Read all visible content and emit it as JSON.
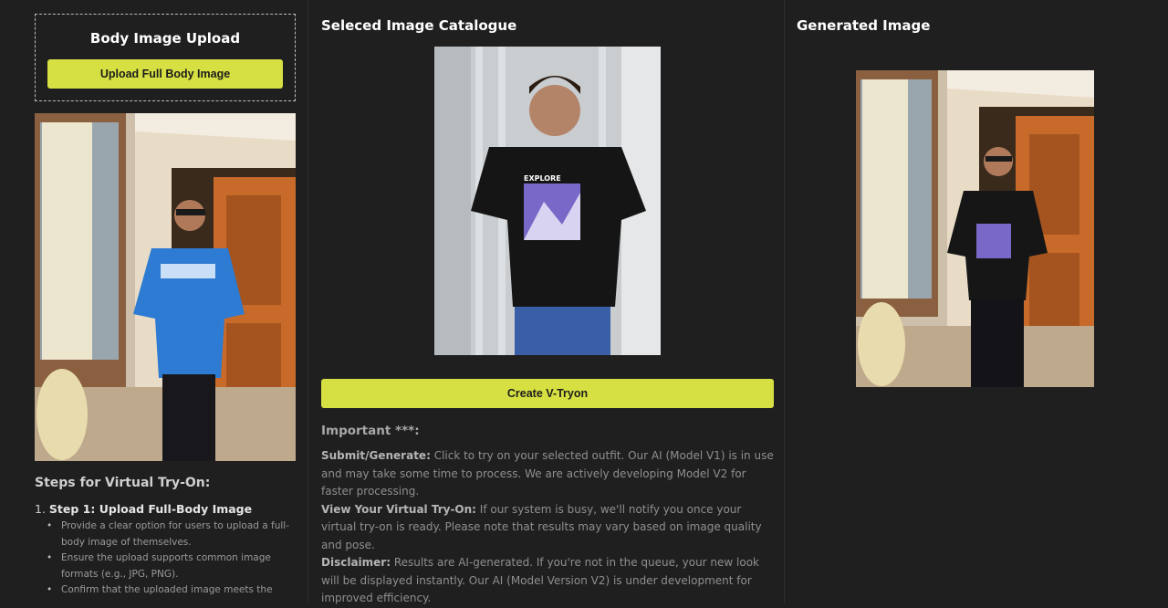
{
  "upload": {
    "title": "Body Image Upload",
    "button_label": "Upload Full Body Image"
  },
  "steps": {
    "title": "Steps for Virtual Try-On:",
    "step1_number": "1.",
    "step1_title": "Step 1: Upload Full-Body Image",
    "bullets": [
      "Provide a clear option for users to upload a full-body image of themselves.",
      "Ensure the upload supports common image formats (e.g., JPG, PNG).",
      "Confirm that the uploaded image meets the"
    ]
  },
  "catalogue": {
    "title": "Seleced Image Catalogue",
    "shirt_text": "EXPLORE",
    "create_button_label": "Create V-Tryon"
  },
  "important": {
    "title": "Important ***:",
    "items": [
      {
        "label": "Submit/Generate:",
        "text": " Click to try on your selected outfit. Our AI (Model V1) is in use and may take some time to process. We are actively developing Model V2 for faster processing."
      },
      {
        "label": "View Your Virtual Try-On:",
        "text": " If our system is busy, we'll notify you once your virtual try-on is ready. Please note that results may vary based on image quality and pose."
      },
      {
        "label": "Disclaimer:",
        "text": " Results are AI-generated. If you're not in the queue, your new look will be displayed instantly. Our AI (Model Version V2) is under development for improved efficiency."
      }
    ]
  },
  "generated": {
    "title": "Generated Image"
  },
  "colors": {
    "accent": "#d6e042",
    "background": "#1f1f1f"
  }
}
